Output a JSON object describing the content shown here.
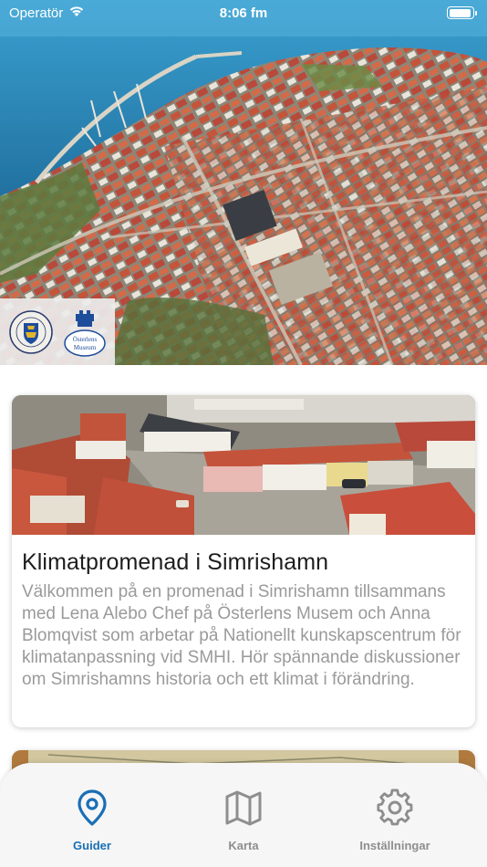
{
  "status_bar": {
    "carrier": "Operatör",
    "time": "8:06 fm",
    "battery_level": 0.95
  },
  "hero": {
    "logos": [
      {
        "name": "simrishamn-seal",
        "text": "SIMRISHAMN"
      },
      {
        "name": "osterlens-museum-logo",
        "text": "ÖSTERLENS MUSEUM"
      }
    ]
  },
  "guides": [
    {
      "title": "Klimatpromenad i Simrishamn",
      "description": "Välkommen på en promenad i Simrishamn tillsammans med Lena Alebo Chef på Österlens Musem och Anna Blomqvist som arbetar på Nationellt kunskapscentrum för klimatanpassning vid SMHI. Hör spännande diskussioner om Simrishamns historia och ett klimat i förändring."
    }
  ],
  "tabs": [
    {
      "label": "Guider",
      "icon": "location-pin-icon",
      "active": true
    },
    {
      "label": "Karta",
      "icon": "map-icon",
      "active": false
    },
    {
      "label": "Inställningar",
      "icon": "gear-icon",
      "active": false
    }
  ],
  "colors": {
    "accent": "#1a6fb5",
    "inactive": "#8e8e8e",
    "description": "#9a9a9a"
  }
}
